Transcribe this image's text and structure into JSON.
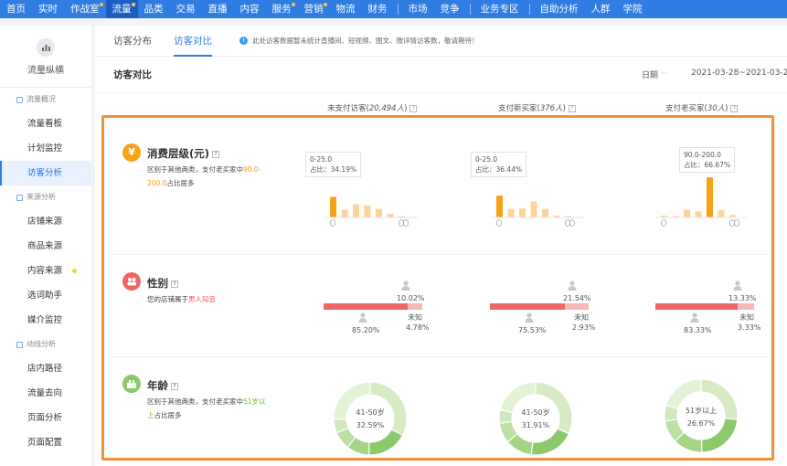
{
  "topnav": {
    "items": [
      {
        "label": "首页",
        "active": false,
        "dot": false
      },
      {
        "label": "实时",
        "active": false,
        "dot": false
      },
      {
        "label": "作战室",
        "active": false,
        "dot": true
      },
      {
        "label": "流量",
        "active": true,
        "dot": true
      },
      {
        "label": "品类",
        "active": false,
        "dot": false
      },
      {
        "label": "交易",
        "active": false,
        "dot": false
      },
      {
        "label": "直播",
        "active": false,
        "dot": false
      },
      {
        "label": "内容",
        "active": false,
        "dot": false
      },
      {
        "label": "服务",
        "active": false,
        "dot": true
      },
      {
        "label": "营销",
        "active": false,
        "dot": true
      },
      {
        "label": "物流",
        "active": false,
        "dot": false
      },
      {
        "label": "财务",
        "active": false,
        "dot": false
      },
      {
        "label": "|",
        "active": false,
        "dot": false
      },
      {
        "label": "市场",
        "active": false,
        "dot": false
      },
      {
        "label": "竞争",
        "active": false,
        "dot": false
      },
      {
        "label": "|",
        "active": false,
        "dot": false
      },
      {
        "label": "业务专区",
        "active": false,
        "dot": false
      },
      {
        "label": "|",
        "active": false,
        "dot": false
      },
      {
        "label": "自助分析",
        "active": false,
        "dot": false
      },
      {
        "label": "人群",
        "active": false,
        "dot": false
      },
      {
        "label": "学院",
        "active": false,
        "dot": false
      }
    ]
  },
  "sidebar": {
    "brand": "流量纵横",
    "groups": [
      {
        "label": "流量概况",
        "items": [
          {
            "label": "流量看板",
            "active": false,
            "dot": false
          },
          {
            "label": "计划监控",
            "active": false,
            "dot": false
          },
          {
            "label": "访客分析",
            "active": true,
            "dot": false
          }
        ]
      },
      {
        "label": "来源分析",
        "items": [
          {
            "label": "店铺来源",
            "active": false,
            "dot": false
          },
          {
            "label": "商品来源",
            "active": false,
            "dot": false
          },
          {
            "label": "内容来源",
            "active": false,
            "dot": true
          },
          {
            "label": "选词助手",
            "active": false,
            "dot": false
          },
          {
            "label": "媒介监控",
            "active": false,
            "dot": false
          }
        ]
      },
      {
        "label": "动线分析",
        "items": [
          {
            "label": "店内路径",
            "active": false,
            "dot": false
          },
          {
            "label": "流量去向",
            "active": false,
            "dot": false
          },
          {
            "label": "页面分析",
            "active": false,
            "dot": false
          },
          {
            "label": "页面配置",
            "active": false,
            "dot": false
          }
        ]
      }
    ]
  },
  "tabs": [
    {
      "label": "访客分布",
      "active": false
    },
    {
      "label": "访客对比",
      "active": true
    }
  ],
  "notice": "此处访客数据暂未统计直播间、短视频、图文、微详情访客数，敬请期待！",
  "section": {
    "title": "访客对比",
    "date_label": "日期",
    "date_range": "2021-03-28~2021-03-28"
  },
  "columns": [
    {
      "prefix": "未支付访客(",
      "count": "20,494人",
      "suffix": ")"
    },
    {
      "prefix": "支付新买家(",
      "count": "376人",
      "suffix": ")"
    },
    {
      "prefix": "支付老买家(",
      "count": "30人",
      "suffix": ")"
    }
  ],
  "rows": {
    "consumption": {
      "icon": "¥",
      "icon_name": "yen-icon",
      "title": "消费层级(元)",
      "desc_pre": "区别于其他两类，支付老买家中",
      "desc_hl": "90.0-200.0",
      "desc_post": "占比居多",
      "accent": "#f7a21b",
      "light": "#fcd49a",
      "tips": [
        {
          "range": "0-25.0",
          "ratio": "占比：34.19%"
        },
        {
          "range": "0-25.0",
          "ratio": "占比：36.44%"
        },
        {
          "range": "90.0-200.0",
          "ratio": "占比：66.67%"
        }
      ],
      "bars": [
        {
          "values": [
            34.19,
            13,
            22,
            20,
            14,
            6,
            2
          ],
          "highlight": 0
        },
        {
          "values": [
            36.44,
            14,
            15,
            27,
            14,
            3,
            1
          ],
          "highlight": 0
        },
        {
          "values": [
            3,
            2,
            13,
            10,
            66.67,
            12,
            4
          ],
          "highlight": 4
        }
      ]
    },
    "gender": {
      "icon_name": "gender-icon",
      "title": "性别",
      "desc_pre": "您的店铺属于",
      "desc_hl": "男人知音",
      "accent": "#ee6666",
      "light": "#f8b9b9",
      "cols": [
        {
          "female": "10.02%",
          "male": "85.20%",
          "unknown_label": "未知",
          "unknown": "4.78%",
          "male_ratio": 85.2
        },
        {
          "female": "21.54%",
          "male": "75.53%",
          "unknown_label": "未知",
          "unknown": "2.93%",
          "male_ratio": 75.53
        },
        {
          "female": "13.33%",
          "male": "83.33%",
          "unknown_label": "未知",
          "unknown": "3.33%",
          "male_ratio": 83.33
        }
      ]
    },
    "age": {
      "icon_name": "age-icon",
      "title": "年龄",
      "desc_pre": "区别于其他两类，支付老买家中",
      "desc_hl": "51岁以上",
      "desc_post": "占比居多",
      "accent": "#8cc96b",
      "donuts": [
        {
          "label": "41-50岁",
          "value": "32.59%",
          "segments": [
            32.59,
            18,
            10,
            8,
            6,
            25.41
          ]
        },
        {
          "label": "41-50岁",
          "value": "31.91%",
          "segments": [
            31.91,
            20,
            12,
            9,
            6,
            21.09
          ]
        },
        {
          "label": "51岁以上",
          "value": "26.67%",
          "segments": [
            26.67,
            23,
            13,
            10,
            7,
            20.33
          ]
        }
      ]
    }
  }
}
